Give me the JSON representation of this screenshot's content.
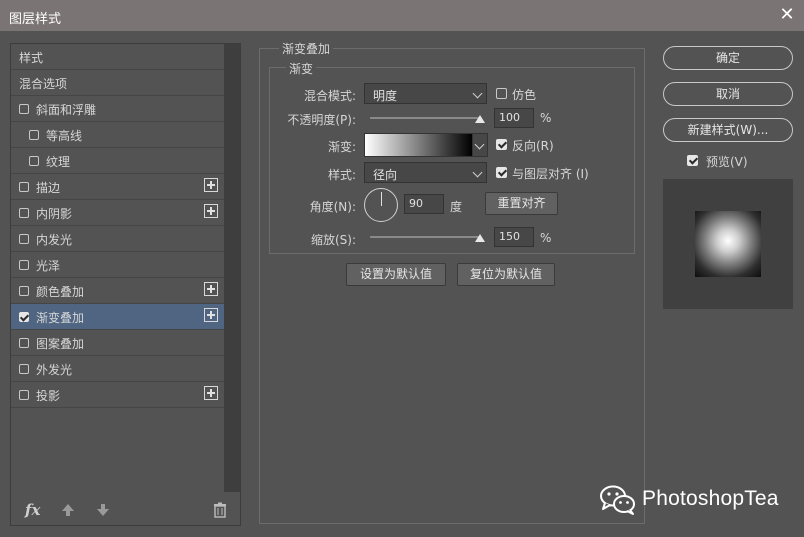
{
  "window": {
    "title": "图层样式",
    "close_icon": "close-icon"
  },
  "left_panel": {
    "items": [
      {
        "label": "样式",
        "checkbox": false,
        "checked": false,
        "plus": false,
        "indent": 0,
        "selected": false
      },
      {
        "label": "混合选项",
        "checkbox": false,
        "checked": false,
        "plus": false,
        "indent": 0,
        "selected": false
      },
      {
        "label": "斜面和浮雕",
        "checkbox": true,
        "checked": false,
        "plus": false,
        "indent": 0,
        "selected": false
      },
      {
        "label": "等高线",
        "checkbox": true,
        "checked": false,
        "plus": false,
        "indent": 1,
        "selected": false
      },
      {
        "label": "纹理",
        "checkbox": true,
        "checked": false,
        "plus": false,
        "indent": 1,
        "selected": false
      },
      {
        "label": "描边",
        "checkbox": true,
        "checked": false,
        "plus": true,
        "indent": 0,
        "selected": false
      },
      {
        "label": "内阴影",
        "checkbox": true,
        "checked": false,
        "plus": true,
        "indent": 0,
        "selected": false
      },
      {
        "label": "内发光",
        "checkbox": true,
        "checked": false,
        "plus": false,
        "indent": 0,
        "selected": false
      },
      {
        "label": "光泽",
        "checkbox": true,
        "checked": false,
        "plus": false,
        "indent": 0,
        "selected": false
      },
      {
        "label": "颜色叠加",
        "checkbox": true,
        "checked": false,
        "plus": true,
        "indent": 0,
        "selected": false
      },
      {
        "label": "渐变叠加",
        "checkbox": true,
        "checked": true,
        "plus": true,
        "indent": 0,
        "selected": true
      },
      {
        "label": "图案叠加",
        "checkbox": true,
        "checked": false,
        "plus": false,
        "indent": 0,
        "selected": false
      },
      {
        "label": "外发光",
        "checkbox": true,
        "checked": false,
        "plus": false,
        "indent": 0,
        "selected": false
      },
      {
        "label": "投影",
        "checkbox": true,
        "checked": false,
        "plus": true,
        "indent": 0,
        "selected": false
      }
    ],
    "bottom_toolbar": {
      "fx_label": "fx",
      "icons": [
        "fx-icon",
        "move-up-icon",
        "move-down-icon",
        "trash-icon"
      ]
    }
  },
  "gradient_overlay": {
    "section_title": "渐变叠加",
    "group_title": "渐变",
    "blend_mode": {
      "label": "混合模式:",
      "value": "明度"
    },
    "dither": {
      "label": "仿色",
      "checked": false
    },
    "opacity": {
      "label": "不透明度(P):",
      "value": "100",
      "unit": "%",
      "fraction": 1.0
    },
    "gradient": {
      "label": "渐变:",
      "colors": [
        "#ffffff",
        "#000000"
      ]
    },
    "reverse": {
      "label": "反向(R)",
      "checked": true
    },
    "style": {
      "label": "样式:",
      "value": "径向"
    },
    "align_layer": {
      "label": "与图层对齐 (I)",
      "checked": true
    },
    "angle": {
      "label": "角度(N):",
      "value": "90",
      "unit": "度"
    },
    "reset_align_button": "重置对齐",
    "scale": {
      "label": "缩放(S):",
      "value": "150",
      "unit": "%",
      "fraction": 1.0
    },
    "set_default_button": "设置为默认值",
    "reset_default_button": "复位为默认值"
  },
  "right_panel": {
    "ok_button": "确定",
    "cancel_button": "取消",
    "new_style_button": "新建样式(W)...",
    "preview": {
      "label": "预览(V)",
      "checked": true
    }
  },
  "watermark": {
    "text": "PhotoshopTea",
    "icon": "wechat-icon"
  },
  "colors": {
    "title_bar": "#7b7474",
    "background": "#535353",
    "selected_row": "#4f6582"
  }
}
